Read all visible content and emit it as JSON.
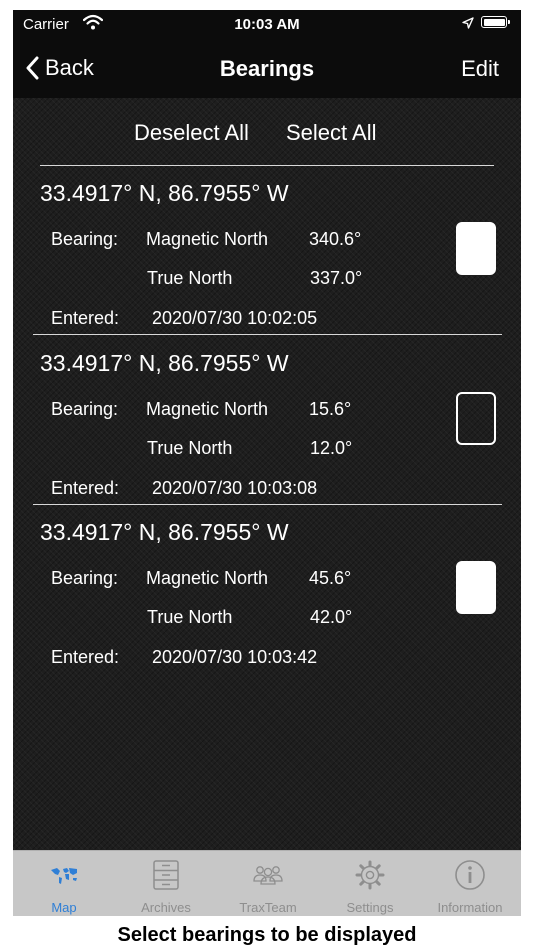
{
  "status_bar": {
    "carrier": "Carrier",
    "time": "10:03 AM"
  },
  "nav": {
    "back_label": "Back",
    "title": "Bearings",
    "edit_label": "Edit"
  },
  "controls": {
    "deselect_all": "Deselect All",
    "select_all": "Select All"
  },
  "labels": {
    "bearing": "Bearing:",
    "magnetic_north": "Magnetic North",
    "true_north": "True North",
    "entered": "Entered:"
  },
  "entries": [
    {
      "coords": "33.4917° N,  86.7955° W",
      "magnetic": "340.6°",
      "true": "337.0°",
      "entered": "2020/07/30 10:02:05",
      "selected": true
    },
    {
      "coords": "33.4917° N,  86.7955° W",
      "magnetic": "15.6°",
      "true": "12.0°",
      "entered": "2020/07/30 10:03:08",
      "selected": false
    },
    {
      "coords": "33.4917° N,  86.7955° W",
      "magnetic": "45.6°",
      "true": "42.0°",
      "entered": "2020/07/30 10:03:42",
      "selected": true
    }
  ],
  "tabs": [
    {
      "label": "Map",
      "icon": "world-map-icon",
      "active": true
    },
    {
      "label": "Archives",
      "icon": "file-cabinet-icon",
      "active": false
    },
    {
      "label": "TraxTeam",
      "icon": "people-group-icon",
      "active": false
    },
    {
      "label": "Settings",
      "icon": "gear-icon",
      "active": false
    },
    {
      "label": "Information",
      "icon": "info-icon",
      "active": false
    }
  ],
  "caption": "Select bearings to be displayed",
  "colors": {
    "background": "#1e1e1e",
    "bar": "#0c0c0c",
    "tabbar": "#c7c7c7",
    "active_tab": "#2f7fd6",
    "inactive_tab": "#8e8e8e"
  }
}
